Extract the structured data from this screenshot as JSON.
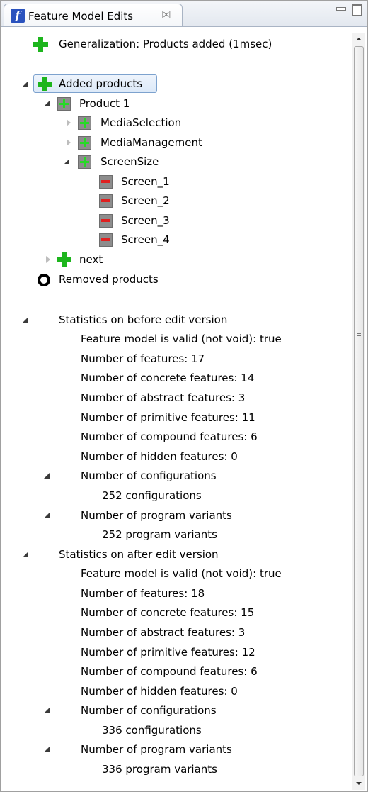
{
  "view": {
    "title": "Feature Model Edits",
    "tab_icon": "feature-ide-icon",
    "close_glyph": "☒"
  },
  "tree": {
    "generalization": "Generalization: Products added (1msec)",
    "added_products": "Added products",
    "product1": "Product 1",
    "media_selection": "MediaSelection",
    "media_management": "MediaManagement",
    "screen_size": "ScreenSize",
    "screens": [
      "Screen_1",
      "Screen_2",
      "Screen_3",
      "Screen_4"
    ],
    "next": "next",
    "removed_products": "Removed products"
  },
  "stats_before": {
    "heading": "Statistics on before edit version",
    "valid": "Feature model is valid (not void): true",
    "features": "Number of features: 17",
    "concrete": "Number of concrete features: 14",
    "abstract": "Number of abstract features: 3",
    "primitive": "Number of primitive features: 11",
    "compound": "Number of compound features: 6",
    "hidden": "Number of hidden features: 0",
    "configurations": "Number of configurations",
    "configurations_value": "252 configurations",
    "variants": "Number of program variants",
    "variants_value": "252 program variants"
  },
  "stats_after": {
    "heading": "Statistics on after edit version",
    "valid": "Feature model is valid (not void): true",
    "features": "Number of features: 18",
    "concrete": "Number of concrete features: 15",
    "abstract": "Number of abstract features: 3",
    "primitive": "Number of primitive features: 12",
    "compound": "Number of compound features: 6",
    "hidden": "Number of hidden features: 0",
    "configurations": "Number of configurations",
    "configurations_value": "336 configurations",
    "variants": "Number of program variants",
    "variants_value": "336 program variants"
  },
  "colors": {
    "added": "#1db51d",
    "removed": "#e02020",
    "selection": "#dce9f8"
  }
}
